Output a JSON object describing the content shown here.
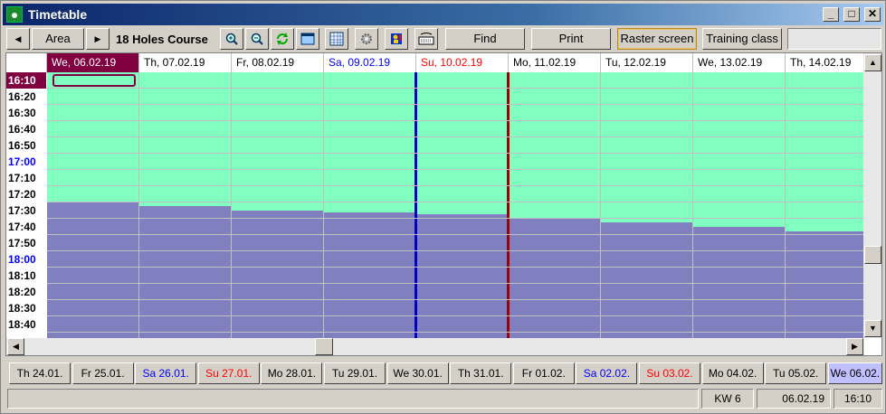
{
  "window": {
    "title": "Timetable",
    "minimize": "_",
    "maximize": "□",
    "close": "✕"
  },
  "toolbar": {
    "prev": "◀",
    "area_label": "Area",
    "next": "▶",
    "course_label": "18 Holes Course",
    "find_label": "Find",
    "print_label": "Print",
    "raster_label": "Raster screen",
    "training_label": "Training class"
  },
  "grid": {
    "days": [
      {
        "label": "We, 06.02.19",
        "color": "#ffffff",
        "bg": "#800040",
        "occupied_from": 17.3
      },
      {
        "label": "Th, 07.02.19",
        "color": "#000000",
        "bg": "#ffffff",
        "occupied_from": 17.32
      },
      {
        "label": "Fr, 08.02.19",
        "color": "#000000",
        "bg": "#ffffff",
        "occupied_from": 17.35
      },
      {
        "label": "Sa, 09.02.19",
        "color": "#0000ff",
        "bg": "#ffffff",
        "occupied_from": 17.36
      },
      {
        "label": "Su, 10.02.19",
        "color": "#ff0000",
        "bg": "#ffffff",
        "occupied_from": 17.37
      },
      {
        "label": "Mo, 11.02.19",
        "color": "#000000",
        "bg": "#ffffff",
        "occupied_from": 17.4
      },
      {
        "label": "Tu, 12.02.19",
        "color": "#000000",
        "bg": "#ffffff",
        "occupied_from": 17.42
      },
      {
        "label": "We, 13.02.19",
        "color": "#000000",
        "bg": "#ffffff",
        "occupied_from": 17.45
      },
      {
        "label": "Th, 14.02.19",
        "color": "#000000",
        "bg": "#ffffff",
        "occupied_from": 17.48
      }
    ],
    "times": [
      {
        "label": "16:10",
        "selected": true,
        "color": "#ffffff"
      },
      {
        "label": "16:20",
        "color": "#000000"
      },
      {
        "label": "16:30",
        "color": "#000000"
      },
      {
        "label": "16:40",
        "color": "#000000"
      },
      {
        "label": "16:50",
        "color": "#000000"
      },
      {
        "label": "17:00",
        "color": "#0000ff"
      },
      {
        "label": "17:10",
        "color": "#000000"
      },
      {
        "label": "17:20",
        "color": "#000000"
      },
      {
        "label": "17:30",
        "color": "#000000"
      },
      {
        "label": "17:40",
        "color": "#000000"
      },
      {
        "label": "17:50",
        "color": "#000000"
      },
      {
        "label": "18:00",
        "color": "#0000ff"
      },
      {
        "label": "18:10",
        "color": "#000000"
      },
      {
        "label": "18:20",
        "color": "#000000"
      },
      {
        "label": "18:30",
        "color": "#000000"
      },
      {
        "label": "18:40",
        "color": "#000000"
      }
    ]
  },
  "date_strip": [
    {
      "label": "Th 24.01.",
      "color": "#000000"
    },
    {
      "label": "Fr 25.01.",
      "color": "#000000"
    },
    {
      "label": "Sa 26.01.",
      "color": "#0000ff"
    },
    {
      "label": "Su 27.01.",
      "color": "#ff0000"
    },
    {
      "label": "Mo 28.01.",
      "color": "#000000"
    },
    {
      "label": "Tu 29.01.",
      "color": "#000000"
    },
    {
      "label": "We 30.01.",
      "color": "#000000"
    },
    {
      "label": "Th 31.01.",
      "color": "#000000"
    },
    {
      "label": "Fr 01.02.",
      "color": "#000000"
    },
    {
      "label": "Sa 02.02.",
      "color": "#0000ff"
    },
    {
      "label": "Su 03.02.",
      "color": "#ff0000"
    },
    {
      "label": "Mo 04.02.",
      "color": "#000000"
    },
    {
      "label": "Tu 05.02.",
      "color": "#000000"
    },
    {
      "label": "We 06.02.",
      "color": "#000000",
      "active": true
    }
  ],
  "status": {
    "week": "KW 6",
    "date": "06.02.19",
    "time": "16:10"
  },
  "colors": {
    "free": "#80ffc0",
    "occupied": "#8080c0",
    "selected": "#800040"
  }
}
